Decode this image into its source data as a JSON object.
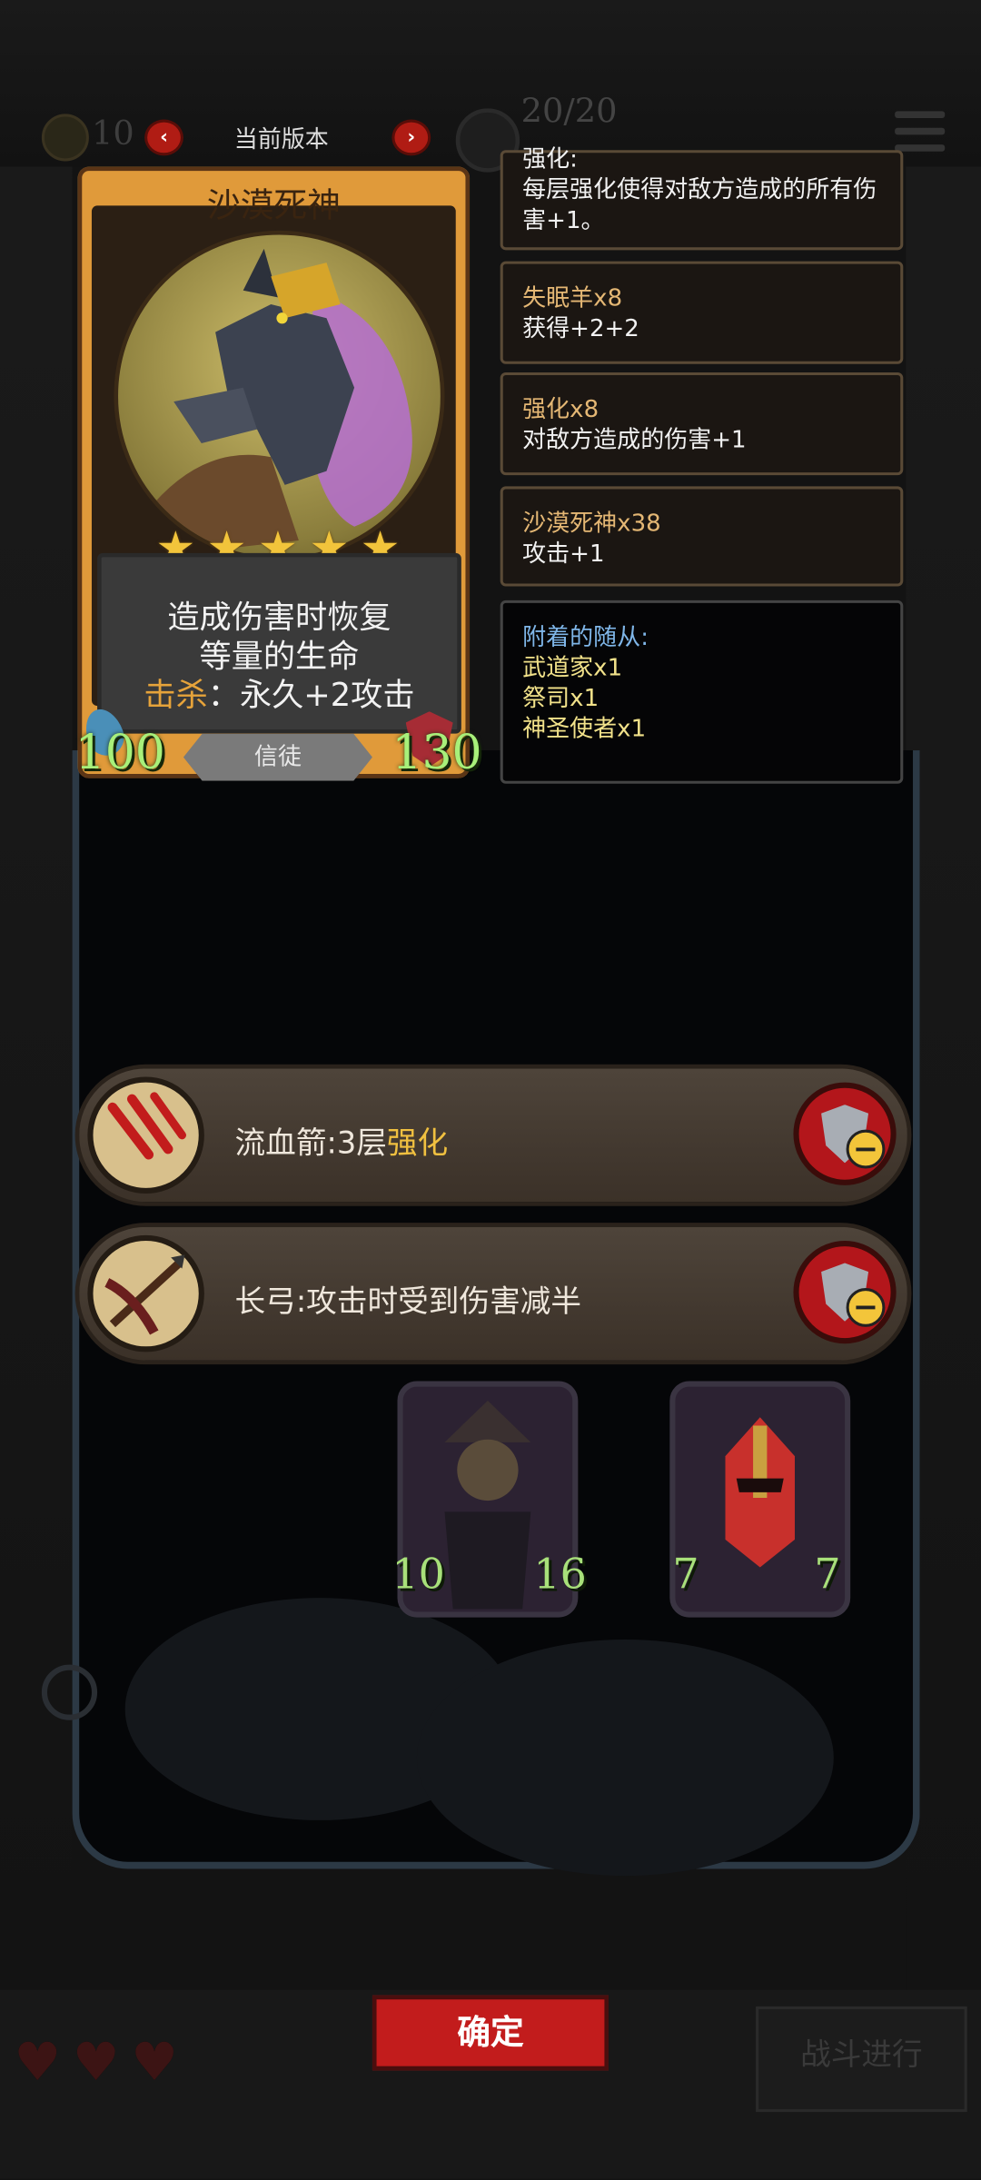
{
  "top_bar": {
    "coins": "10",
    "version_label": "当前版本",
    "prev_arrow": "‹",
    "next_arrow": "›",
    "health": "20/20"
  },
  "card": {
    "name": "沙漠死神",
    "stars": 5,
    "star_glyph": "★",
    "ability_line1": "造成伤害时恢复",
    "ability_line2": "等量的生命",
    "ability_kill_label": "击杀",
    "ability_kill_text": "：永久+2攻击",
    "attack": "100",
    "health": "130",
    "tribe": "信徒"
  },
  "panels": [
    {
      "title": "强化:",
      "body": "每层强化使得对敌方造成的所有伤害+1。"
    },
    {
      "title": "失眠羊x8",
      "body": "获得+2+2"
    },
    {
      "title": "强化x8",
      "body": "对敌方造成的伤害+1"
    },
    {
      "title": "沙漠死神x38",
      "body": "攻击+1"
    }
  ],
  "attached": {
    "title": "附着的随从:",
    "items": [
      "武道家x1",
      "祭司x1",
      "神圣使者x1"
    ]
  },
  "buffs": [
    {
      "name": "流血箭:3层",
      "highlight": "强化"
    },
    {
      "name": "长弓:攻击时受到伤害减半",
      "highlight": ""
    }
  ],
  "minions": [
    {
      "attack": "10",
      "health": "16"
    },
    {
      "attack": "7",
      "health": "7"
    }
  ],
  "bottom": {
    "confirm_label": "确定",
    "battle_label": "战斗进行"
  },
  "colors": {
    "accent_red": "#c21c1c",
    "card_gold": "#e09a3a",
    "stat_green": "#a8f07a",
    "highlight_yellow": "#f0c040"
  }
}
